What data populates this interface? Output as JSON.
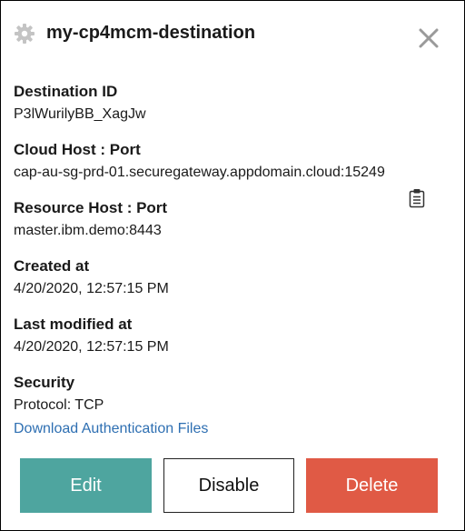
{
  "header": {
    "title": "my-cp4mcm-destination",
    "icon": "gear-icon",
    "close_icon": "close-icon"
  },
  "fields": [
    {
      "label": "Destination ID",
      "value": "P3lWurilyBB_XagJw"
    },
    {
      "label": "Cloud Host : Port",
      "value": "cap-au-sg-prd-01.securegateway.appdomain.cloud:15249"
    },
    {
      "label": "Resource Host : Port",
      "value": "master.ibm.demo:8443"
    },
    {
      "label": "Created at",
      "value": "4/20/2020, 12:57:15 PM"
    },
    {
      "label": "Last modified at",
      "value": "4/20/2020, 12:57:15 PM"
    },
    {
      "label": "Security",
      "value": "Protocol: TCP"
    }
  ],
  "copy_icon": "clipboard-icon",
  "download_link": "Download Authentication Files",
  "buttons": {
    "edit": "Edit",
    "disable": "Disable",
    "delete": "Delete"
  },
  "colors": {
    "edit": "#4ea59f",
    "delete": "#e05a45",
    "link": "#2e6fb2",
    "gear": "#c4c4c4",
    "close": "#9a9a9a"
  }
}
